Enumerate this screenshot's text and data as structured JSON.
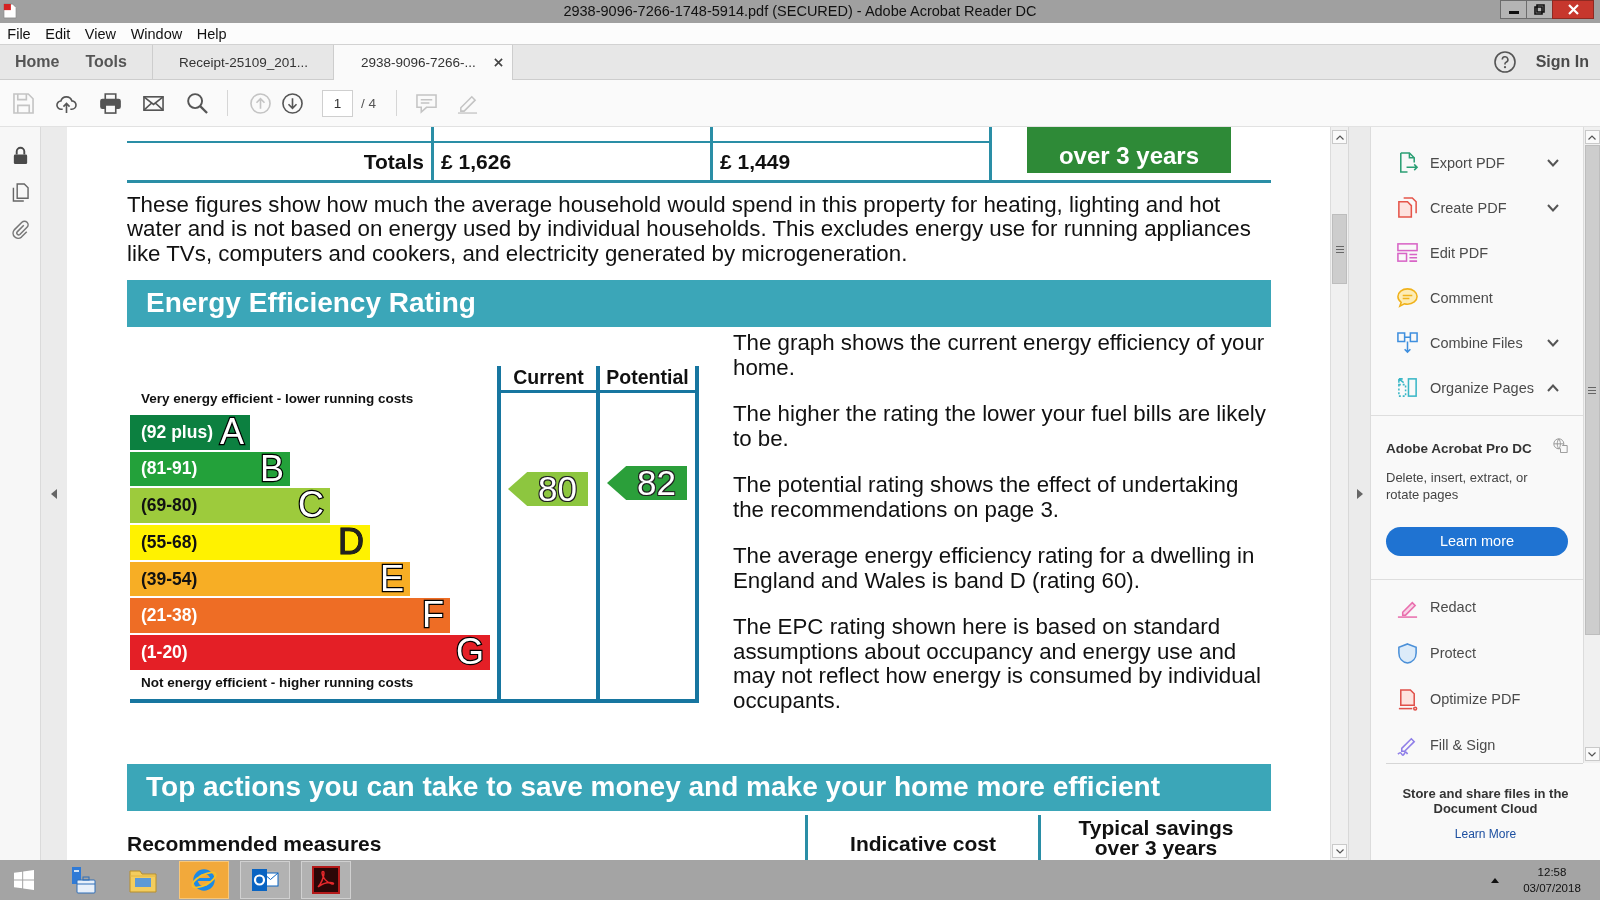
{
  "window": {
    "title": "2938-9096-7266-1748-5914.pdf (SECURED) - Adobe Acrobat Reader DC"
  },
  "menu": [
    "File",
    "Edit",
    "View",
    "Window",
    "Help"
  ],
  "nav": [
    "Home",
    "Tools"
  ],
  "tabs": [
    {
      "label": "Receipt-25109_201...",
      "selected": false
    },
    {
      "label": "2938-9096-7266-...",
      "selected": true
    }
  ],
  "account": {
    "sign_in": "Sign In"
  },
  "toolbar": {
    "file_tools": [
      {
        "disabled": true
      },
      {
        "disabled": false
      },
      {
        "disabled": false
      },
      {
        "disabled": false
      },
      {
        "disabled": false
      }
    ],
    "page_nav": [
      {
        "disabled": true
      },
      {
        "disabled": false
      }
    ],
    "page_number": "1",
    "page_count": "/ 4",
    "annotate_tools": [
      {
        "disabled": true
      },
      {
        "disabled": true
      }
    ]
  },
  "document": {
    "totals": {
      "label": "Totals",
      "current": "£ 1,626",
      "potential": "£ 1,449",
      "savings": "over 3 years"
    },
    "note": "These figures show how much the average household would spend in this property for heating, lighting and hot water and is not based on energy used by individual households. This excludes energy use for running appliances like TVs, computers and cookers, and electricity generated by microgeneration.",
    "rating_heading": "Energy Efficiency Rating",
    "rating_chart": {
      "top_caption": "Very energy efficient - lower running costs",
      "bottom_caption": "Not energy efficient - higher running costs",
      "bands": [
        {
          "range": "(92 plus)",
          "letter": "A",
          "color": "#0c8040"
        },
        {
          "range": "(81-91)",
          "letter": "B",
          "color": "#23a13a"
        },
        {
          "range": "(69-80)",
          "letter": "C",
          "color": "#9dcb3c"
        },
        {
          "range": "(55-68)",
          "letter": "D",
          "color": "#fff200"
        },
        {
          "range": "(39-54)",
          "letter": "E",
          "color": "#f7ae25"
        },
        {
          "range": "(21-38)",
          "letter": "F",
          "color": "#ee6d25"
        },
        {
          "range": "(1-20)",
          "letter": "G",
          "color": "#e41f26"
        }
      ],
      "columns": [
        {
          "label": "Current",
          "value": "80",
          "color": "#8dc63f"
        },
        {
          "label": "Potential",
          "value": "82",
          "color": "#2b9f3a"
        }
      ]
    },
    "rating_notes": [
      "The graph shows the current energy efficiency of your home.",
      "The higher the rating the lower your fuel bills are likely to be.",
      "The potential rating shows the effect of undertaking the recommendations on page 3.",
      "The average energy efficiency rating for a dwelling in England and Wales is band D (rating 60).",
      "The EPC rating shown here is based on standard assumptions about occupancy and energy use and may not reflect how energy is consumed by individual occupants."
    ],
    "actions_heading": "Top actions you can take to save money and make your home more efficient",
    "measures_columns": [
      "Recommended measures",
      "Indicative cost",
      "Typical savings over 3 years"
    ]
  },
  "right_panel": {
    "tools": [
      {
        "label": "Export PDF",
        "expanded": false
      },
      {
        "label": "Create PDF",
        "expanded": false
      },
      {
        "label": "Edit PDF"
      },
      {
        "label": "Comment"
      },
      {
        "label": "Combine Files",
        "expanded": false
      },
      {
        "label": "Organize Pages",
        "expanded": true
      }
    ],
    "promo": {
      "title": "Adobe Acrobat Pro DC",
      "text": "Delete, insert, extract, or rotate pages",
      "button": "Learn more"
    },
    "more_tools": [
      "Redact",
      "Protect",
      "Optimize PDF",
      "Fill & Sign"
    ],
    "cloud": {
      "text": "Store and share files in the Document Cloud",
      "link": "Learn More"
    }
  },
  "taskbar": {
    "apps": [
      {
        "running": false,
        "hovered": false
      },
      {
        "running": false,
        "hovered": false
      },
      {
        "running": false,
        "hovered": true
      },
      {
        "running": true,
        "hovered": false
      },
      {
        "running": true,
        "hovered": false
      }
    ],
    "time": "12:58",
    "date": "03/07/2018"
  }
}
